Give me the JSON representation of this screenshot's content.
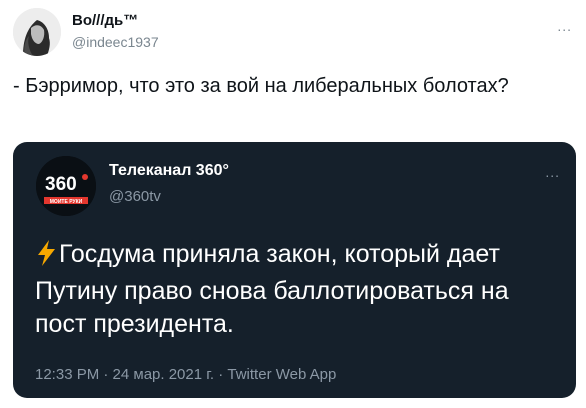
{
  "outer_tweet": {
    "display_name": "Bo///дь™",
    "handle": "@indeec1937",
    "more_label": "...",
    "text": "- Бэрримор, что это за вой на либеральных болотах?"
  },
  "quoted_tweet": {
    "display_name": "Телеканал 360°",
    "handle": "@360tv",
    "more_label": "...",
    "avatar_logo": {
      "number": "360",
      "tagline": "МОИТЕ РУКИ"
    },
    "emoji": "lightning-bolt",
    "text": "Госдума приняла закон, который дает Путину право снова баллотироваться на пост президента.",
    "meta": "12:33 PM · 24 мар. 2021 г. · Twitter Web App"
  },
  "colors": {
    "card_bg": "#15202b",
    "secondary_text": "#8b98a5",
    "bolt": "#f6a800",
    "logo_red": "#e4372e"
  }
}
